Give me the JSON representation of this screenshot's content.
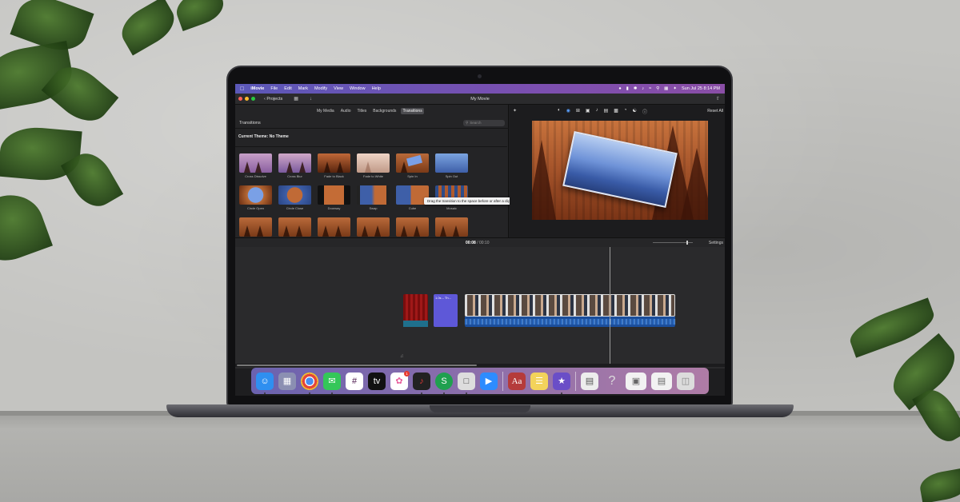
{
  "menubar": {
    "app": "iMovie",
    "items": [
      "File",
      "Edit",
      "Mark",
      "Modify",
      "View",
      "Window",
      "Help"
    ],
    "datetime": "Sun Jul 25  8:14 PM"
  },
  "titlebar": {
    "projects_label": "Projects",
    "title": "My Movie"
  },
  "browser": {
    "tabs": [
      "My Media",
      "Audio",
      "Titles",
      "Backgrounds",
      "Transitions"
    ],
    "active_tab": "Transitions",
    "section_label": "Transitions",
    "search_placeholder": "Search",
    "current_theme": "Current Theme: No Theme",
    "transitions": [
      {
        "name": "Cross Dissolve"
      },
      {
        "name": "Cross Blur"
      },
      {
        "name": "Fade to Black"
      },
      {
        "name": "Fade to White"
      },
      {
        "name": "Spin In"
      },
      {
        "name": "Spin Out"
      },
      {
        "name": "Circle Open"
      },
      {
        "name": "Circle Close"
      },
      {
        "name": "Doorway"
      },
      {
        "name": "Swap"
      },
      {
        "name": "Cube"
      },
      {
        "name": "Mosaic"
      }
    ],
    "tooltip": "Drag the transition to the space before or after a clip"
  },
  "viewer": {
    "reset_label": "Reset All"
  },
  "timeline": {
    "current_time": "00:08",
    "total_time": "00:10",
    "separator": "/",
    "settings_label": "Settings",
    "title_clip_label": "1.0s – Th..."
  },
  "dock": {
    "icons": [
      {
        "name": "finder-icon",
        "color": "#2f8ff0"
      },
      {
        "name": "launchpad-icon",
        "color": "#e45a5a"
      },
      {
        "name": "chrome-icon",
        "color": "#3e8e41"
      },
      {
        "name": "messages-icon",
        "color": "#34c759"
      },
      {
        "name": "slack-icon",
        "color": "#4a154b"
      },
      {
        "name": "apple-tv-icon",
        "color": "#111111"
      },
      {
        "name": "photos-icon",
        "color": "#f2b134",
        "badge": "1"
      },
      {
        "name": "voice-memos-icon",
        "color": "#222222"
      },
      {
        "name": "money-icon",
        "color": "#1fa04f"
      },
      {
        "name": "screenshot-icon",
        "color": "#666666"
      },
      {
        "name": "zoom-icon",
        "color": "#2d8cff"
      },
      {
        "name": "dictionary-icon",
        "color": "#b53b3b"
      },
      {
        "name": "notes-icon",
        "color": "#f3d35b"
      },
      {
        "name": "imovie-icon",
        "color": "#6a4ec7"
      },
      {
        "name": "preview-icon",
        "color": "#ededed"
      },
      {
        "name": "help-icon",
        "color": "transparent"
      },
      {
        "name": "recent-window-icon",
        "color": "#f2f2f2"
      },
      {
        "name": "recent-doc-icon",
        "color": "#f2f2f2"
      },
      {
        "name": "trash-icon",
        "color": "#dcdcdc"
      }
    ]
  }
}
